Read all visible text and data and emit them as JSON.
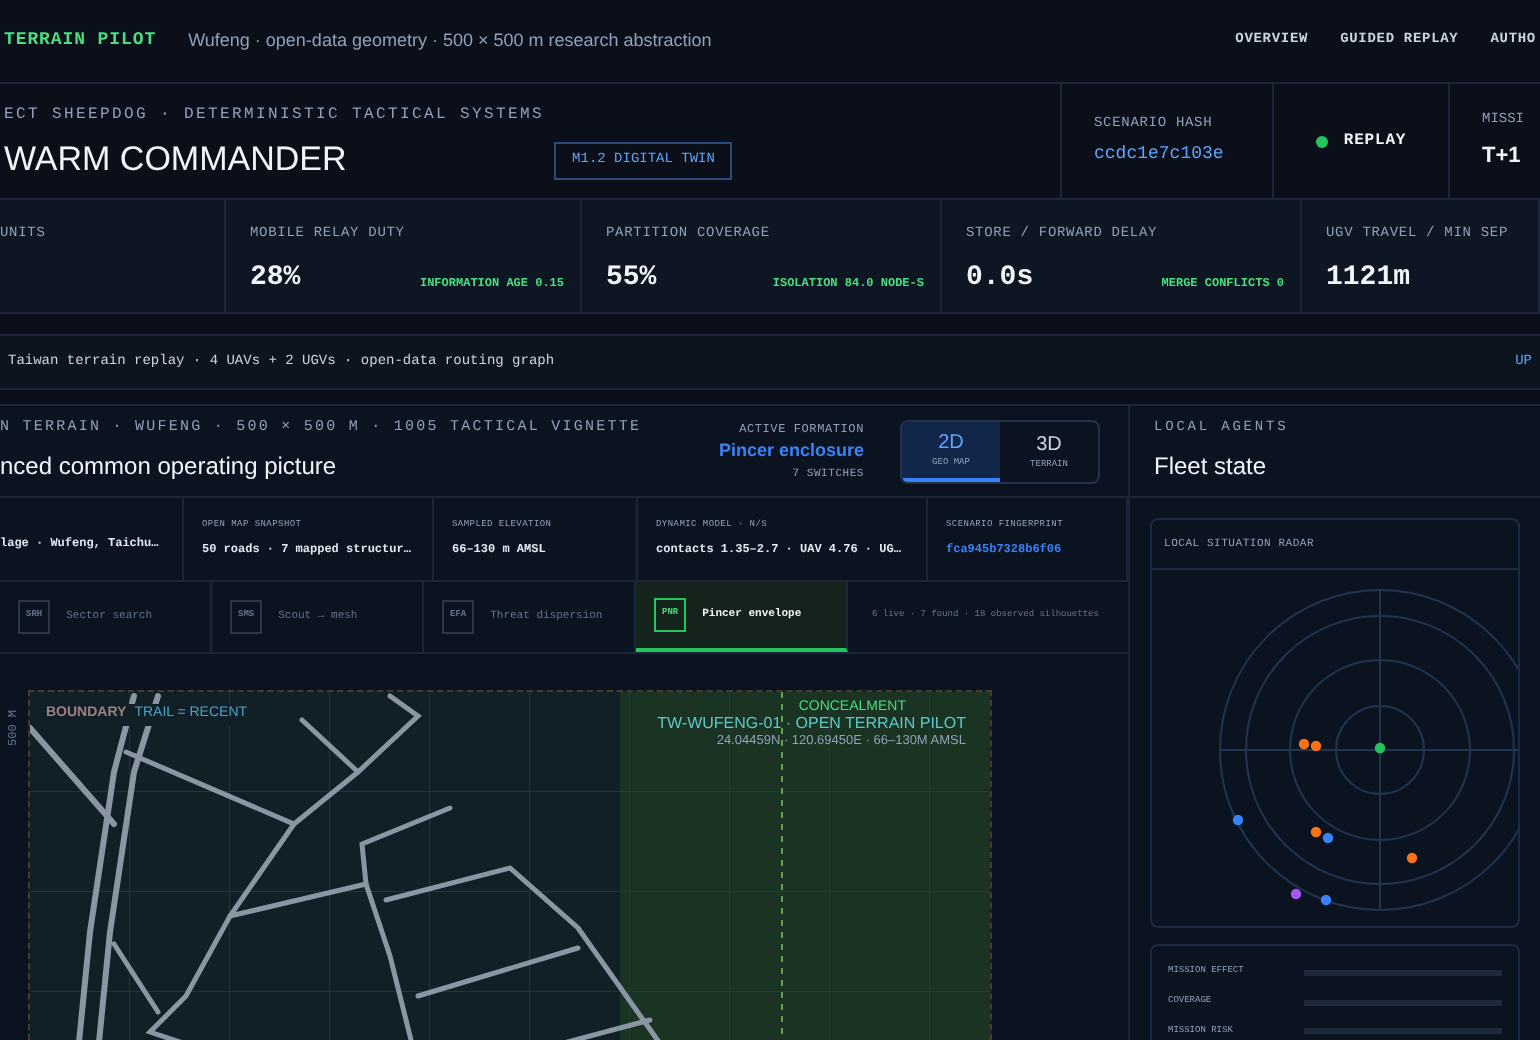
{
  "top_bar": {
    "brand": "TERRAIN PILOT",
    "subtitle": "Wufeng · open-data geometry · 500 × 500 m research abstraction",
    "nav": [
      "OVERVIEW",
      "GUIDED REPLAY",
      "AUTHO"
    ]
  },
  "header": {
    "eyebrow": "ECT SHEEPDOG · DETERMINISTIC TACTICAL SYSTEMS",
    "title": "WARM COMMANDER",
    "badge": "M1.2 DIGITAL TWIN",
    "hash_label": "SCENARIO HASH",
    "hash": "ccdc1e7c103e",
    "mode": "REPLAY",
    "mission_label": "MISSI",
    "mission_value": "T+1"
  },
  "metrics": [
    {
      "label": "UNITS"
    },
    {
      "label": "MOBILE RELAY DUTY",
      "value": "28%",
      "note": "INFORMATION AGE 0.15"
    },
    {
      "label": "PARTITION COVERAGE",
      "value": "55%",
      "note": "ISOLATION 84.0 NODE-S"
    },
    {
      "label": "STORE / FORWARD DELAY",
      "value": "0.0s",
      "note": "MERGE CONFLICTS 0"
    },
    {
      "label": "UGV TRAVEL / MIN SEP",
      "value": "1121m"
    }
  ],
  "info_bar": {
    "text": "Taiwan terrain replay · 4 UAVs + 2 UGVs · open-data routing graph",
    "link": "UP"
  },
  "main": {
    "eyebrow": "N TERRAIN · WUFENG · 500 × 500 M · 1005 TACTICAL VIGNETTE",
    "title": "nced common operating picture",
    "formation_label": "ACTIVE FORMATION",
    "formation": "Pincer enclosure",
    "switches": "7 SWITCHES",
    "view_tabs": [
      {
        "label": "2D",
        "sub": "GEO MAP",
        "selected": true
      },
      {
        "label": "3D",
        "sub": "TERRAIN",
        "selected": false
      }
    ],
    "facts": [
      {
        "value": "lage · Wufeng, Taichu…",
        "link": false
      },
      {
        "label": "OPEN MAP SNAPSHOT",
        "value": "50 roads · 7 mapped structur…",
        "link": false
      },
      {
        "label": "SAMPLED ELEVATION",
        "value": "66–130 m AMSL",
        "link": false
      },
      {
        "label": "DYNAMIC MODEL · N/S",
        "value": "contacts 1.35–2.7 · UAV 4.76 · UG…",
        "link": false
      },
      {
        "label": "SCENARIO FINGERPRINT",
        "value": "fca945b7328b6f06",
        "link": true
      }
    ],
    "formations": [
      {
        "code": "SRH",
        "name": "Sector search",
        "selected": false
      },
      {
        "code": "SMS",
        "name": "Scout → mesh",
        "selected": false
      },
      {
        "code": "EFA",
        "name": "Threat dispersion",
        "selected": false
      },
      {
        "code": "PNR",
        "name": "Pincer envelope",
        "selected": true
      }
    ],
    "formation_status": "6 live · 7 found · 18 observed silhouettes",
    "map": {
      "axis_label": "500 M",
      "legend_a": "BOUNDARY",
      "legend_b": "TRAIL = RECENT",
      "zone": "CONCEALMENT",
      "site": "TW-WUFENG-01 · OPEN TERRAIN PILOT",
      "coords": "24.04459N · 120.69450E · 66–130M AMSL"
    }
  },
  "fleet": {
    "eyebrow": "LOCAL AGENTS",
    "title": "Fleet state",
    "radar_title": "LOCAL SITUATION RADAR",
    "radar_contacts": [
      {
        "color": "#22c55e"
      },
      {
        "color": "#f97316"
      },
      {
        "color": "#f97316"
      },
      {
        "color": "#3b82f6"
      },
      {
        "color": "#f97316"
      },
      {
        "color": "#3b82f6"
      },
      {
        "color": "#f97316"
      },
      {
        "color": "#a855f7"
      },
      {
        "color": "#3b82f6"
      }
    ],
    "rows": [
      "MISSION EFFECT",
      "COVERAGE",
      "MISSION RISK"
    ]
  }
}
